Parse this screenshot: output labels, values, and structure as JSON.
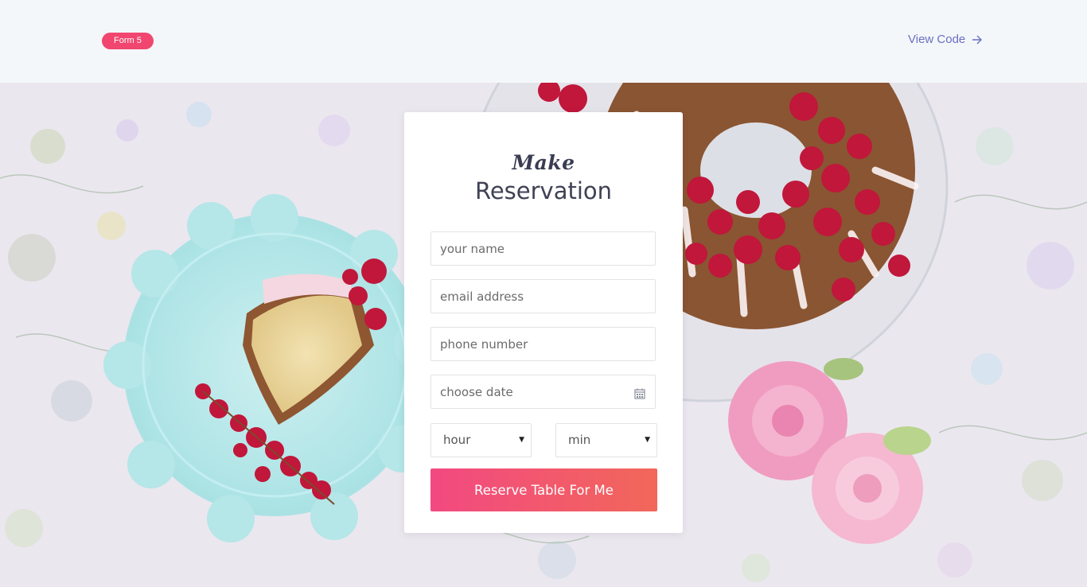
{
  "header": {
    "badge_label": "Form 5",
    "view_code_label": "View Code",
    "view_code_icon": "arrow-right-icon"
  },
  "form": {
    "title_script": "Make",
    "title_main": "Reservation",
    "name_placeholder": "your name",
    "email_placeholder": "email address",
    "phone_placeholder": "phone number",
    "date_placeholder": "choose date",
    "date_icon": "calendar-icon",
    "hour_label": "hour",
    "min_label": "min",
    "submit_label": "Reserve Table For Me"
  },
  "colors": {
    "accent": "#f0466f",
    "link": "#6b6fc2",
    "button_start": "#f24981",
    "button_end": "#f2675a"
  }
}
